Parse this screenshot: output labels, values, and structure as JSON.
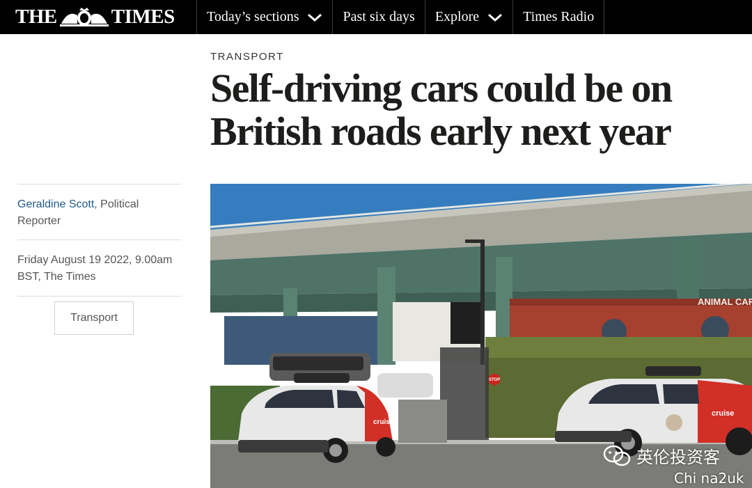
{
  "nav": {
    "logo_left": "THE",
    "logo_right": "TIMES",
    "items": [
      {
        "label": "Today’s sections",
        "icon": "chevron-down-icon"
      },
      {
        "label": "Past six days"
      },
      {
        "label": "Explore",
        "icon": "chevron-down-icon"
      },
      {
        "label": "Times Radio"
      }
    ]
  },
  "article": {
    "section": "TRANSPORT",
    "headline_line1": "Self-driving cars could be on",
    "headline_line2": "British roads early next year",
    "author": "Geraldine Scott",
    "author_role": ", Political Reporter",
    "dateline": "Friday August 19 2022, 9.00am BST, The Times",
    "tag": "Transport"
  },
  "photo": {
    "building_sign": "ANIMAL CARE",
    "stop_sign": "STOP",
    "car_brand": "cruise"
  },
  "watermark": {
    "wechat_text": "英伦投资客",
    "site_text": "Chi na2uk"
  },
  "colors": {
    "nav_bg": "#000000",
    "author_link": "#215a8d",
    "car_red": "#d22f27",
    "overpass_green": "#5f8576"
  }
}
